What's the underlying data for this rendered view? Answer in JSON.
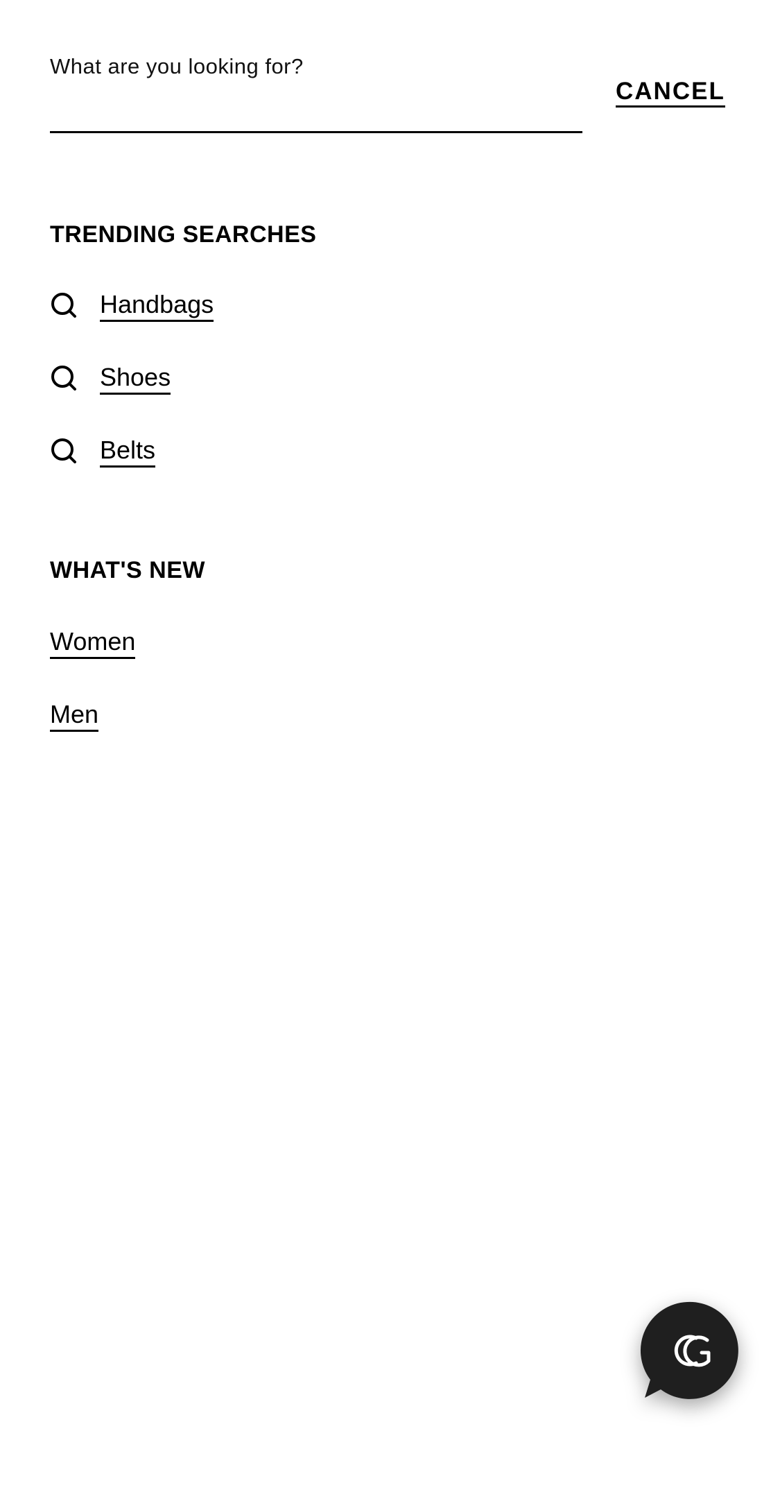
{
  "search": {
    "label": "What are you looking for?",
    "value": "",
    "placeholder": "",
    "cancel_label": "CANCEL"
  },
  "trending": {
    "heading": "TRENDING SEARCHES",
    "items": [
      {
        "label": "Handbags",
        "icon": "search-icon"
      },
      {
        "label": "Shoes",
        "icon": "search-icon"
      },
      {
        "label": "Belts",
        "icon": "search-icon"
      }
    ]
  },
  "whats_new": {
    "heading": "WHAT'S NEW",
    "items": [
      {
        "label": "Women"
      },
      {
        "label": "Men"
      }
    ]
  },
  "chat": {
    "icon": "gg-logo-chat-icon",
    "color": "#1f1f1f"
  },
  "colors": {
    "text": "#000000",
    "background": "#ffffff",
    "chat_bubble": "#1f1f1f"
  }
}
